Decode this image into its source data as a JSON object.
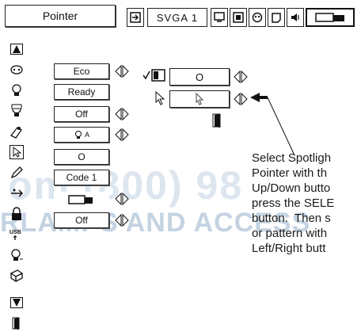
{
  "header": {
    "menu_title": "Pointer",
    "input_label": "SVGA 1"
  },
  "settings": [
    {
      "value": "Eco"
    },
    {
      "value": "Ready"
    },
    {
      "value": "Off"
    },
    {
      "value": "A",
      "icon": "bulb-icon"
    },
    {
      "value": "O"
    },
    {
      "value": "Code 1"
    },
    {
      "value": "",
      "icon": "projector-icon"
    },
    {
      "value": "Off"
    }
  ],
  "pointer_menu": {
    "spotlight_value": "O",
    "spotlight_icon": "spotlight-icon",
    "arrow_icon": "arrow-pointer-icon",
    "exit_icon": "exit-door-icon"
  },
  "caption": "Select Spotligh\nPointer with th\nUp/Down butto\npress the SELE\nbutton.  Then s\nor pattern with\nLeft/Right butt",
  "watermark": {
    "line1": "om (800) 98",
    "line2": "RLAMPS AND ACCESS"
  }
}
